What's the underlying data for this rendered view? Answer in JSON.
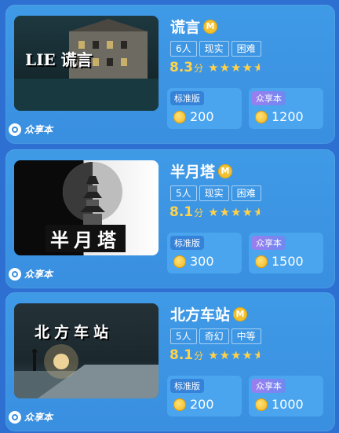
{
  "cards": [
    {
      "title": "谎言",
      "badge": "M",
      "tags": [
        "6人",
        "现实",
        "困难"
      ],
      "score": "8.3",
      "score_unit": "分",
      "stars": 4.6,
      "std_label": "标准版",
      "std_price": "200",
      "share_label": "众享本",
      "share_price": "1200",
      "brand": "众享本",
      "thumb_text": "LIE 谎言"
    },
    {
      "title": "半月塔",
      "badge": "M",
      "tags": [
        "5人",
        "现实",
        "困难"
      ],
      "score": "8.1",
      "score_unit": "分",
      "stars": 4.6,
      "std_label": "标准版",
      "std_price": "300",
      "share_label": "众享本",
      "share_price": "1500",
      "brand": "众享本",
      "thumb_text": "半月塔"
    },
    {
      "title": "北方车站",
      "badge": "M",
      "tags": [
        "5人",
        "奇幻",
        "中等"
      ],
      "score": "8.1",
      "score_unit": "分",
      "stars": 4.6,
      "std_label": "标准版",
      "std_price": "200",
      "share_label": "众享本",
      "share_price": "1000",
      "brand": "众享本",
      "thumb_text": "北方车站"
    }
  ],
  "colors": {
    "accent": "#ffd24a",
    "card": "#3f9ae6",
    "background": "#2e6fd2"
  }
}
